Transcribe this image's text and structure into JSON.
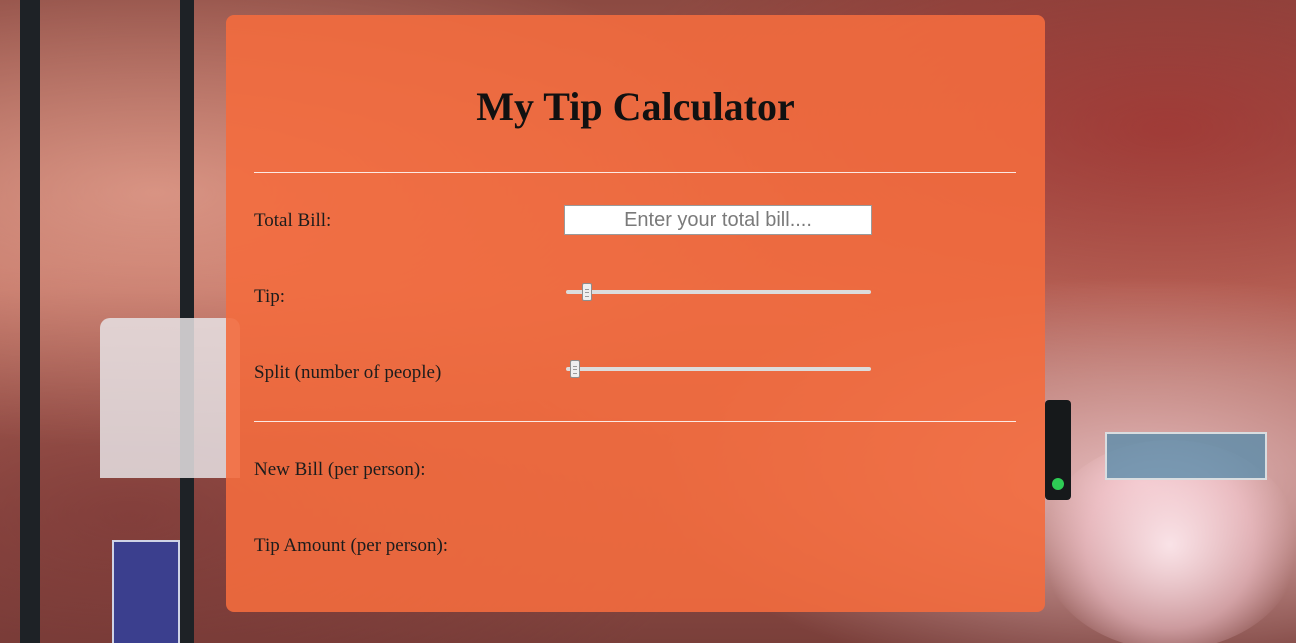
{
  "app": {
    "title": "My Tip Calculator"
  },
  "form": {
    "total_bill_label": "Total Bill:",
    "total_bill_placeholder": "Enter your total bill....",
    "total_bill_value": "",
    "tip_label": "Tip:",
    "tip_slider_level": 0.06,
    "split_label": "Split (number of people)",
    "split_slider_level": 0.02
  },
  "results": {
    "new_bill_label": "New Bill (per person):",
    "new_bill_value": "",
    "tip_amount_label": "Tip Amount (per person):",
    "tip_amount_value": ""
  },
  "theme": {
    "panel_color": "#f36c3e",
    "text_color": "#111111"
  }
}
